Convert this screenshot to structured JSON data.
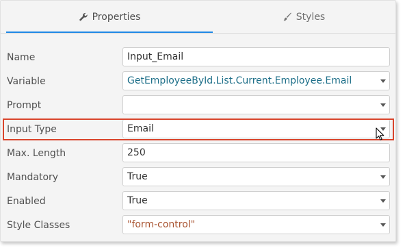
{
  "tabs": [
    {
      "label": "Properties",
      "icon": "wrench-icon",
      "active": true
    },
    {
      "label": "Styles",
      "icon": "brush-icon",
      "active": false
    }
  ],
  "accent_color": "#1e88e5",
  "highlight_color": "#d9442b",
  "properties": [
    {
      "label": "Name",
      "value": "Input_Email",
      "dropdown": false
    },
    {
      "label": "Variable",
      "value": "GetEmployeeById.List.Current.Employee.Email",
      "dropdown": true
    },
    {
      "label": "Prompt",
      "value": "",
      "dropdown": true
    },
    {
      "label": "Input Type",
      "value": "Email",
      "dropdown": true,
      "highlighted": true
    },
    {
      "label": "Max. Length",
      "value": "250",
      "dropdown": false
    },
    {
      "label": "Mandatory",
      "value": "True",
      "dropdown": true
    },
    {
      "label": "Enabled",
      "value": "True",
      "dropdown": true
    },
    {
      "label": "Style Classes",
      "value": "\"form-control\"",
      "dropdown": true
    }
  ]
}
